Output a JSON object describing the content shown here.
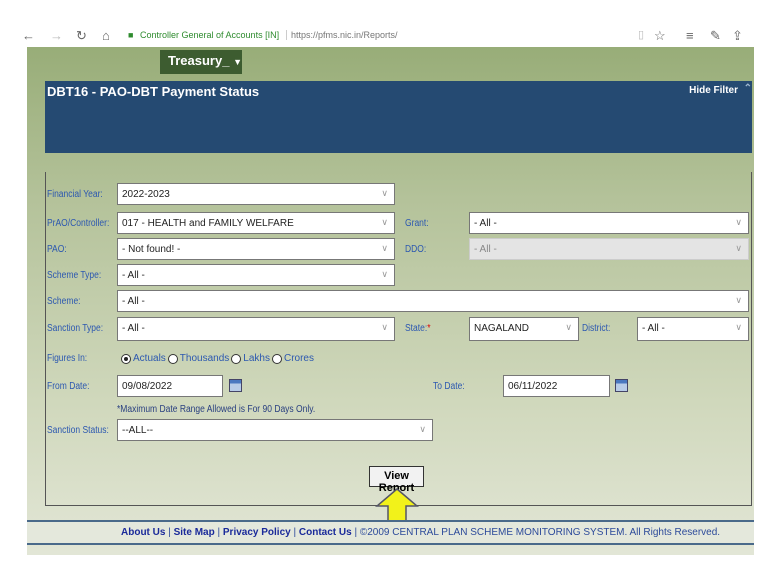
{
  "browser": {
    "site_identity": "Controller General of Accounts [IN]",
    "url": "https://pfms.nic.in/Reports/"
  },
  "menu": {
    "treasury": "Treasury_"
  },
  "header": {
    "title": "DBT16 - PAO-DBT Payment Status",
    "hide_filter": "Hide Filter"
  },
  "form": {
    "financial_year": {
      "label": "Financial Year:",
      "value": "2022-2023"
    },
    "controller": {
      "label": "PrAO/Controller:",
      "value": "017 - HEALTH and FAMILY WELFARE"
    },
    "grant": {
      "label": "Grant:",
      "value": "- All -"
    },
    "pao": {
      "label": "PAO:",
      "value": "- Not found! -"
    },
    "ddo": {
      "label": "DDO:",
      "value": "- All -"
    },
    "scheme_type": {
      "label": "Scheme Type:",
      "value": "- All -"
    },
    "scheme": {
      "label": "Scheme:",
      "value": "- All -"
    },
    "sanction_type": {
      "label": "Sanction Type:",
      "value": "- All -"
    },
    "state": {
      "label": "State:",
      "required": "*",
      "value": "NAGALAND"
    },
    "district": {
      "label": "District:",
      "value": "- All -"
    },
    "figures_in": {
      "label": "Figures In:",
      "options": [
        "Actuals",
        "Thousands",
        "Lakhs",
        "Crores"
      ],
      "selected": "Actuals"
    },
    "from_date": {
      "label": "From Date:",
      "value": "09/08/2022"
    },
    "to_date": {
      "label": "To Date:",
      "value": "06/11/2022"
    },
    "note": "*Maximum Date Range Allowed is For 90 Days Only.",
    "sanction_status": {
      "label": "Sanction Status:",
      "value": "--ALL--"
    },
    "view_report": "View Report"
  },
  "footer": {
    "links": [
      "About Us",
      "Site Map",
      "Privacy Policy",
      "Contact Us"
    ],
    "copyright": "©2009 CENTRAL PLAN SCHEME MONITORING SYSTEM. All Rights Reserved."
  },
  "colors": {
    "header": "#254a72",
    "label": "#2c58b0",
    "arrow": "#f2f21a"
  }
}
